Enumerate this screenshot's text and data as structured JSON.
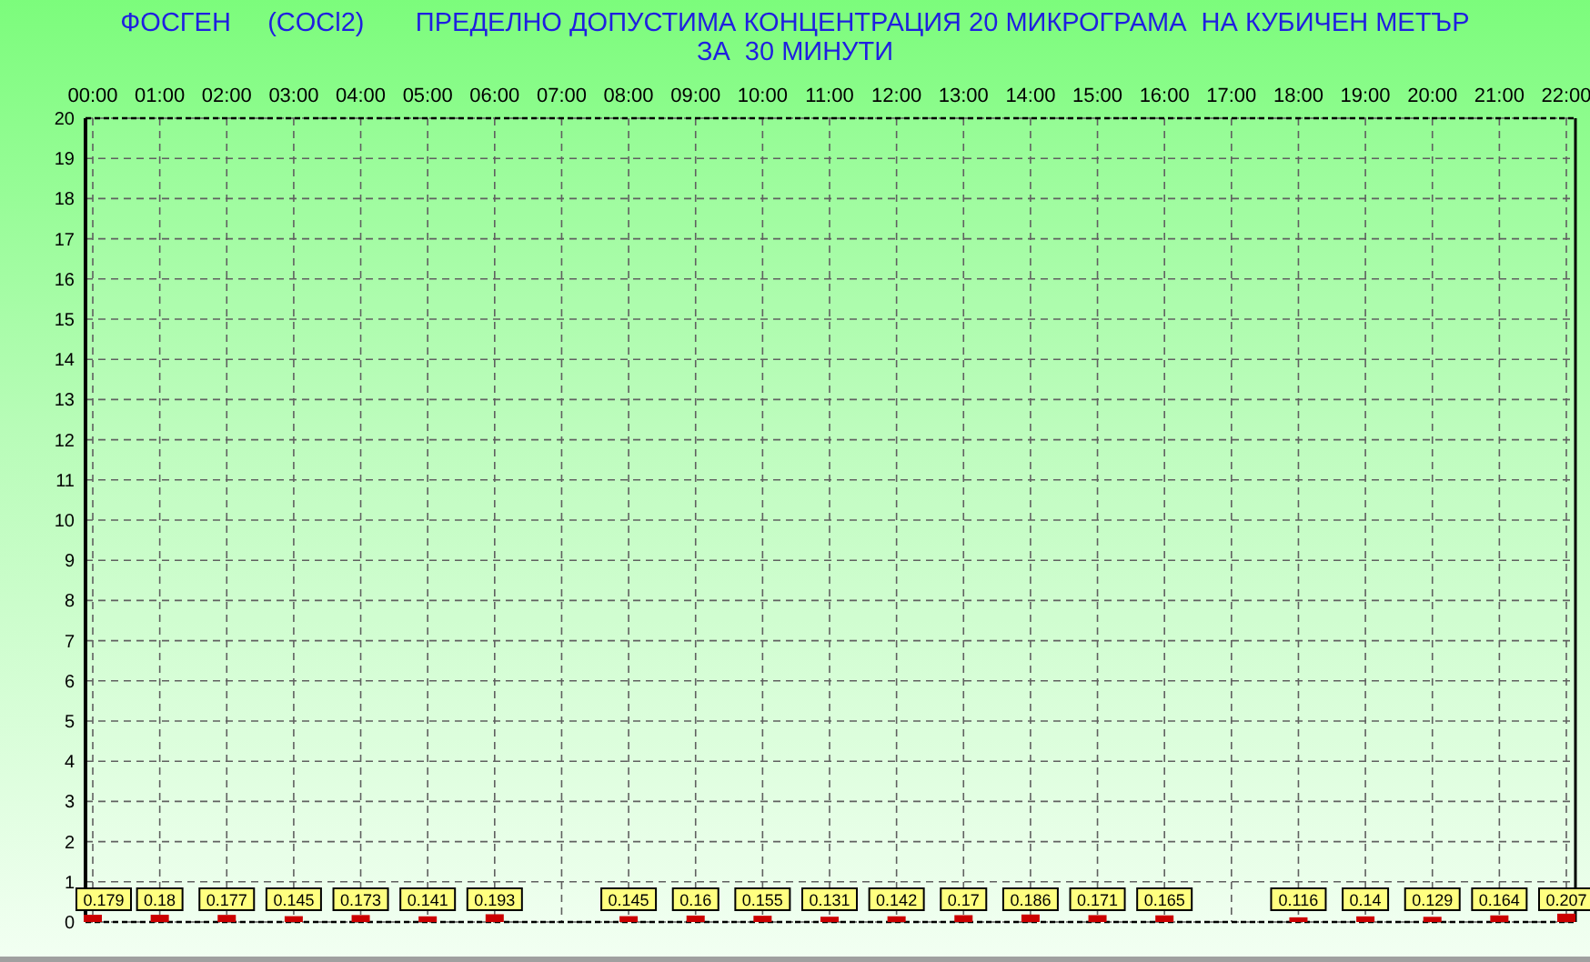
{
  "header": {
    "lines": [
      "ФОСГЕН     (COCl2)       ПРЕДЕЛНО ДОПУСТИМА КОНЦЕНТРАЦИЯ 20 МИКРОГРАМА  НА КУБИЧЕН МЕТЪР",
      "ЗА  30 МИНУТИ"
    ]
  },
  "chart_data": {
    "type": "bar",
    "categories": [
      "00:00",
      "01:00",
      "02:00",
      "03:00",
      "04:00",
      "05:00",
      "06:00",
      "07:00",
      "08:00",
      "09:00",
      "10:00",
      "11:00",
      "12:00",
      "13:00",
      "14:00",
      "15:00",
      "16:00",
      "17:00",
      "18:00",
      "19:00",
      "20:00",
      "21:00",
      "22:00"
    ],
    "series": [
      {
        "color": "#cc0000",
        "values": [
          0.179,
          0.18,
          0.177,
          0.145,
          0.173,
          0.141,
          0.193,
          null,
          0.145,
          0.16,
          0.155,
          0.131,
          0.142,
          0.17,
          0.186,
          0.171,
          0.165,
          null,
          0.116,
          0.14,
          0.129,
          0.164,
          0.207
        ]
      }
    ],
    "ylim": [
      0,
      20
    ],
    "yticks": [
      0,
      1,
      2,
      3,
      4,
      5,
      6,
      7,
      8,
      9,
      10,
      11,
      12,
      13,
      14,
      15,
      16,
      17,
      18,
      19,
      20
    ],
    "grid": true,
    "data_labels": true
  }
}
